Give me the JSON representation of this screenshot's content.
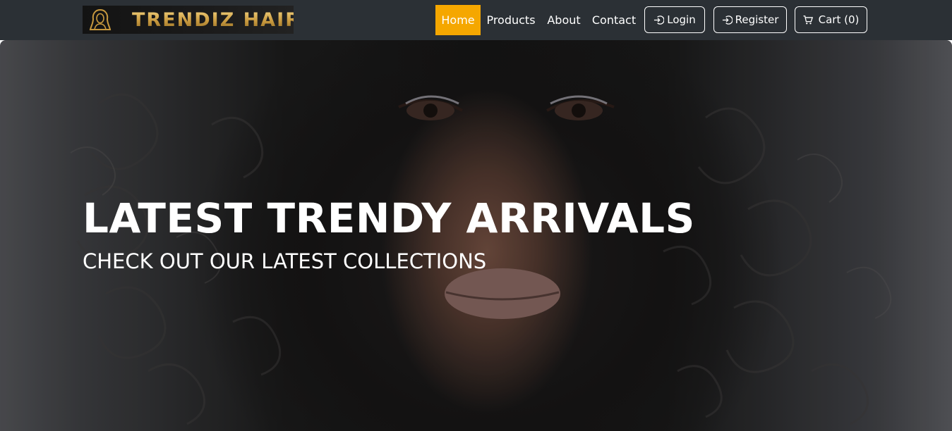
{
  "brand": {
    "logo_text": "TRENDIZ HAIR",
    "logo_icon": "woman-silhouette-icon"
  },
  "nav": {
    "items": [
      {
        "label": "Home",
        "active": true
      },
      {
        "label": "Products",
        "active": false
      },
      {
        "label": "About",
        "active": false
      },
      {
        "label": "Contact",
        "active": false
      }
    ],
    "login_label": "Login",
    "register_label": "Register",
    "cart_label": "Cart (0)",
    "login_icon": "sign-in-icon",
    "register_icon": "sign-in-icon",
    "cart_icon": "cart-icon"
  },
  "hero": {
    "title": "LATEST TRENDY ARRIVALS",
    "subtitle": "CHECK OUT OUR LATEST COLLECTIONS"
  },
  "colors": {
    "navbar_bg": "#2b3035",
    "active_nav_bg": "#f5a700",
    "logo_gold": "#d4a84b",
    "text_light": "#ffffff"
  }
}
